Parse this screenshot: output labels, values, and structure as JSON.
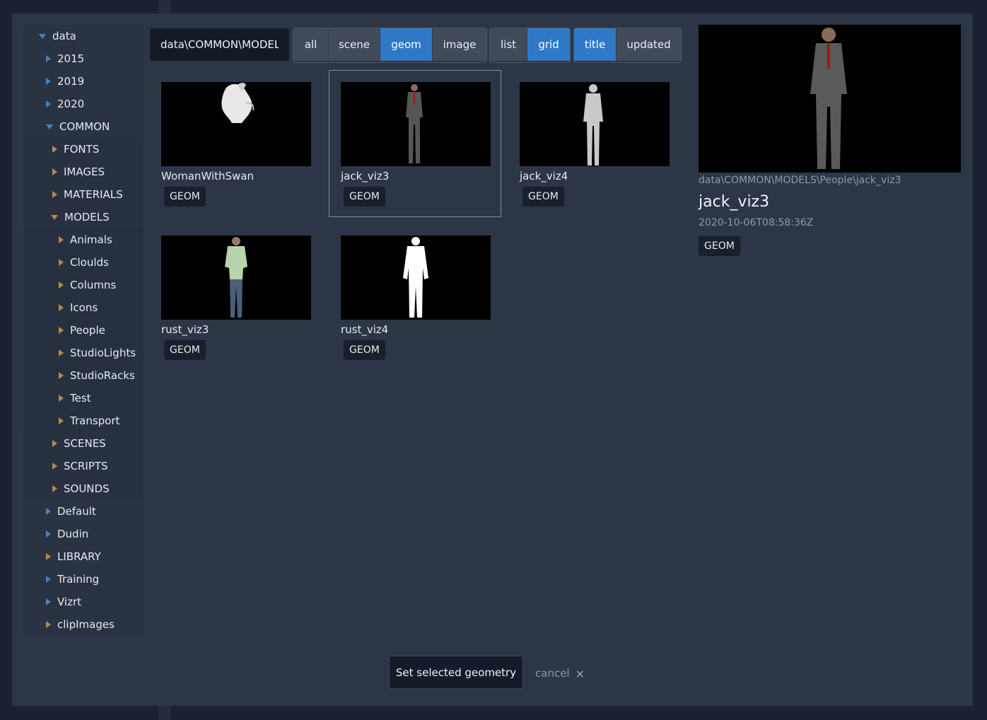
{
  "tree": {
    "items": [
      {
        "label": "data",
        "expanded": true
      },
      {
        "label": "2015"
      },
      {
        "label": "2019"
      },
      {
        "label": "2020"
      },
      {
        "label": "COMMON",
        "expanded": true
      },
      {
        "label": "FONTS"
      },
      {
        "label": "IMAGES"
      },
      {
        "label": "MATERIALS"
      },
      {
        "label": "MODELS",
        "expanded": true
      },
      {
        "label": "Animals"
      },
      {
        "label": "Cloulds"
      },
      {
        "label": "Columns"
      },
      {
        "label": "Icons"
      },
      {
        "label": "People"
      },
      {
        "label": "StudioLights"
      },
      {
        "label": "StudioRacks"
      },
      {
        "label": "Test"
      },
      {
        "label": "Transport"
      },
      {
        "label": "SCENES"
      },
      {
        "label": "SCRIPTS"
      },
      {
        "label": "SOUNDS"
      },
      {
        "label": "Default"
      },
      {
        "label": "Dudin"
      },
      {
        "label": "LIBRARY"
      },
      {
        "label": "Training"
      },
      {
        "label": "Vizrt"
      },
      {
        "label": "clipImages"
      }
    ]
  },
  "toolbar": {
    "path_value": "data\\COMMON\\MODELS\\People",
    "filter_buttons": [
      {
        "label": "all",
        "active": false
      },
      {
        "label": "scene",
        "active": false
      },
      {
        "label": "geom",
        "active": true
      },
      {
        "label": "image",
        "active": false
      }
    ],
    "view_buttons": [
      {
        "label": "list",
        "active": false
      },
      {
        "label": "grid",
        "active": true
      }
    ],
    "sort_buttons": [
      {
        "label": "title",
        "active": true
      },
      {
        "label": "updated",
        "active": false
      }
    ]
  },
  "grid": {
    "items": [
      {
        "title": "WomanWithSwan",
        "type": "GEOM",
        "selected": false
      },
      {
        "title": "jack_viz3",
        "type": "GEOM",
        "selected": true
      },
      {
        "title": "jack_viz4",
        "type": "GEOM",
        "selected": false
      },
      {
        "title": "rust_viz3",
        "type": "GEOM",
        "selected": false
      },
      {
        "title": "rust_viz4",
        "type": "GEOM",
        "selected": false
      }
    ]
  },
  "detail": {
    "path": "data\\COMMON\\MODELS\\People\\jack_viz3",
    "title": "jack_viz3",
    "updated": "2020-10-06T08:58:36Z",
    "type": "GEOM"
  },
  "footer": {
    "set_button": "Set selected geometry",
    "cancel_label": "cancel",
    "cancel_icon": "×"
  },
  "colors": {
    "accent": "#2f78c8",
    "modal_bg": "#2d3646",
    "folder_caret": "#b8884a",
    "tree_caret": "#3b86cc"
  }
}
